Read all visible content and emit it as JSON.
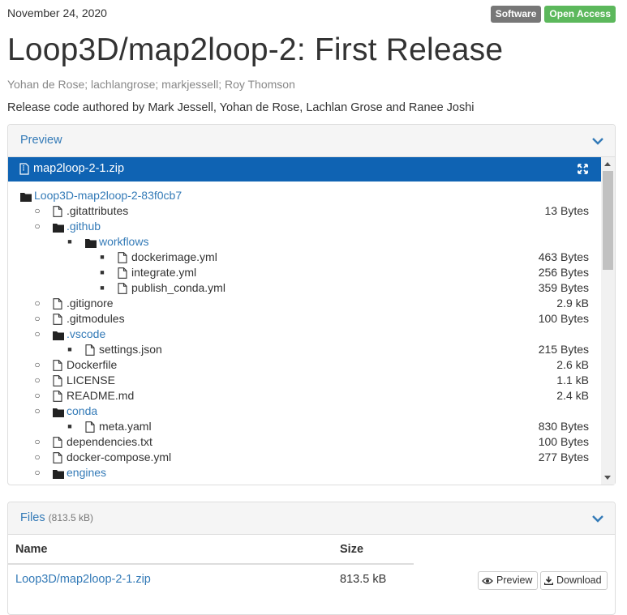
{
  "date": "November 24, 2020",
  "badges": {
    "software": "Software",
    "open_access": "Open Access"
  },
  "title": "Loop3D/map2loop-2: First Release",
  "authors": "Yohan de Rose; lachlangrose; markjessell; Roy Thomson",
  "description": "Release code authored by Mark Jessell, Yohan de Rose, Lachlan Grose and Ranee Joshi",
  "preview": {
    "heading": "Preview",
    "file_name": "map2loop-2-1.zip",
    "tree": [
      {
        "label": "Loop3D-map2loop-2-83f0cb7",
        "type": "folder",
        "depth": 0,
        "size": ""
      },
      {
        "label": ".gitattributes",
        "type": "file",
        "depth": 1,
        "size": "13 Bytes"
      },
      {
        "label": ".github",
        "type": "folder",
        "depth": 1,
        "size": ""
      },
      {
        "label": "workflows",
        "type": "folder",
        "depth": 2,
        "size": ""
      },
      {
        "label": "dockerimage.yml",
        "type": "file",
        "depth": 3,
        "size": "463 Bytes"
      },
      {
        "label": "integrate.yml",
        "type": "file",
        "depth": 3,
        "size": "256 Bytes"
      },
      {
        "label": "publish_conda.yml",
        "type": "file",
        "depth": 3,
        "size": "359 Bytes"
      },
      {
        "label": ".gitignore",
        "type": "file",
        "depth": 1,
        "size": "2.9 kB"
      },
      {
        "label": ".gitmodules",
        "type": "file",
        "depth": 1,
        "size": "100 Bytes"
      },
      {
        "label": ".vscode",
        "type": "folder",
        "depth": 1,
        "size": ""
      },
      {
        "label": "settings.json",
        "type": "file",
        "depth": 2,
        "size": "215 Bytes"
      },
      {
        "label": "Dockerfile",
        "type": "file",
        "depth": 1,
        "size": "2.6 kB"
      },
      {
        "label": "LICENSE",
        "type": "file",
        "depth": 1,
        "size": "1.1 kB"
      },
      {
        "label": "README.md",
        "type": "file",
        "depth": 1,
        "size": "2.4 kB"
      },
      {
        "label": "conda",
        "type": "folder",
        "depth": 1,
        "size": ""
      },
      {
        "label": "meta.yaml",
        "type": "file",
        "depth": 2,
        "size": "830 Bytes"
      },
      {
        "label": "dependencies.txt",
        "type": "file",
        "depth": 1,
        "size": "100 Bytes"
      },
      {
        "label": "docker-compose.yml",
        "type": "file",
        "depth": 1,
        "size": "277 Bytes"
      },
      {
        "label": "engines",
        "type": "folder",
        "depth": 1,
        "size": ""
      }
    ]
  },
  "files": {
    "heading": "Files",
    "total_size": "(813.5 kB)",
    "col_name": "Name",
    "col_size": "Size",
    "rows": [
      {
        "name": "Loop3D/map2loop-2-1.zip",
        "size": "813.5 kB",
        "preview_label": "Preview",
        "download_label": "Download"
      }
    ]
  },
  "colors": {
    "accent": "#337ab7",
    "file_bar": "#0f63b3",
    "software_badge": "#777777",
    "open_access_badge": "#5cb85c"
  }
}
